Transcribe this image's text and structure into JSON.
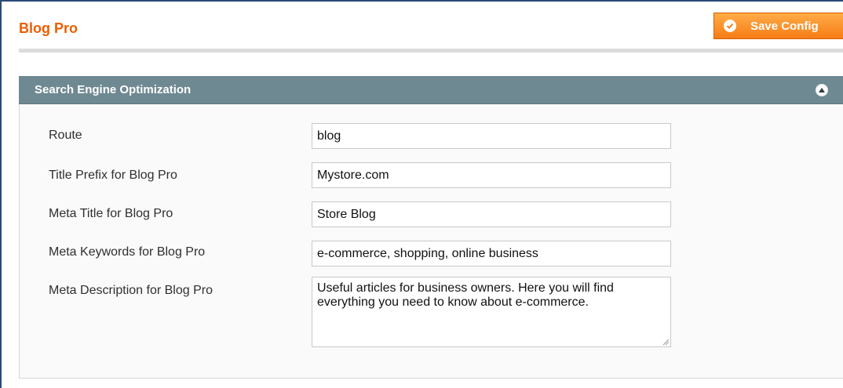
{
  "page": {
    "title": "Blog Pro",
    "save_button_label": "Save Config",
    "save_icon": "check-circle-icon",
    "accent_color": "#eb5e00",
    "button_color": "#f77c16"
  },
  "section": {
    "title": "Search Engine Optimization",
    "collapse_icon": "collapse-up-circle-icon",
    "header_color": "#6f8992"
  },
  "fields": {
    "route": {
      "label": "Route",
      "value": "blog"
    },
    "title_prefix": {
      "label": "Title Prefix for Blog Pro",
      "value": "Mystore.com"
    },
    "meta_title": {
      "label": "Meta Title for Blog Pro",
      "value": "Store Blog"
    },
    "meta_keywords": {
      "label": "Meta Keywords for Blog Pro",
      "value": "e-commerce, shopping, online business"
    },
    "meta_description": {
      "label": "Meta Description for Blog Pro",
      "value": "Useful articles for business owners. Here you will find everything you need to know about e-commerce."
    }
  }
}
